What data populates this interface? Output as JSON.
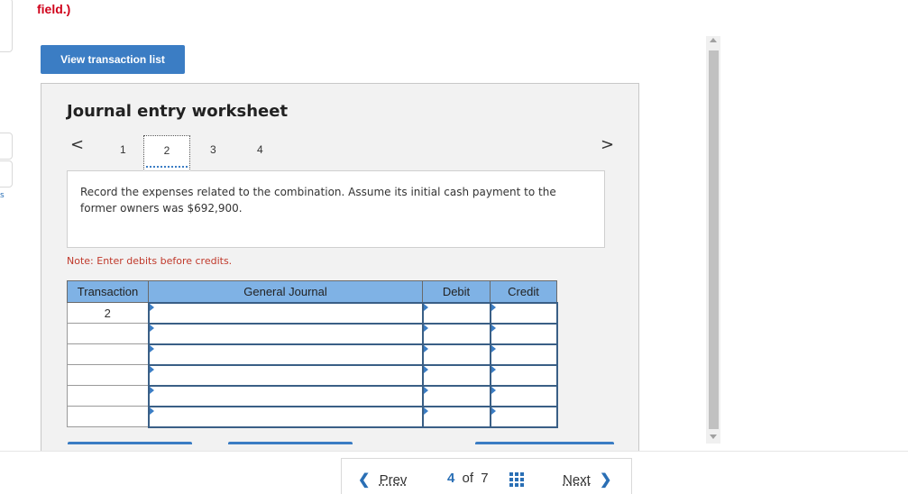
{
  "page": {
    "top_fragment": "field.)"
  },
  "toolbar": {
    "view_transactions_label": "View transaction list"
  },
  "worksheet": {
    "title": "Journal entry worksheet",
    "pager": {
      "prev_symbol": "<",
      "next_symbol": ">",
      "pages": [
        "1",
        "2",
        "3",
        "4"
      ],
      "active_page": "2"
    },
    "instruction": "Record the expenses related to the combination. Assume its initial cash payment to the former owners was $692,900.",
    "note": "Note: Enter debits before credits.",
    "table": {
      "headers": [
        "Transaction",
        "General Journal",
        "Debit",
        "Credit"
      ],
      "rows": [
        {
          "transaction": "2",
          "account": "",
          "debit": "",
          "credit": ""
        },
        {
          "transaction": "",
          "account": "",
          "debit": "",
          "credit": ""
        },
        {
          "transaction": "",
          "account": "",
          "debit": "",
          "credit": ""
        },
        {
          "transaction": "",
          "account": "",
          "debit": "",
          "credit": ""
        },
        {
          "transaction": "",
          "account": "",
          "debit": "",
          "credit": ""
        },
        {
          "transaction": "",
          "account": "",
          "debit": "",
          "credit": ""
        }
      ]
    }
  },
  "navigation": {
    "prev_label": "Prev",
    "current": "4",
    "of_label": "of",
    "total": "7",
    "next_label": "Next"
  },
  "colors": {
    "accent": "#3b7dc4",
    "header_blue": "#7fb2e5",
    "error_red": "#d0021b",
    "note_red": "#c0392b"
  },
  "icons": {
    "prev": "chevron-left-icon",
    "next": "chevron-right-icon",
    "grid": "grid-icon"
  }
}
